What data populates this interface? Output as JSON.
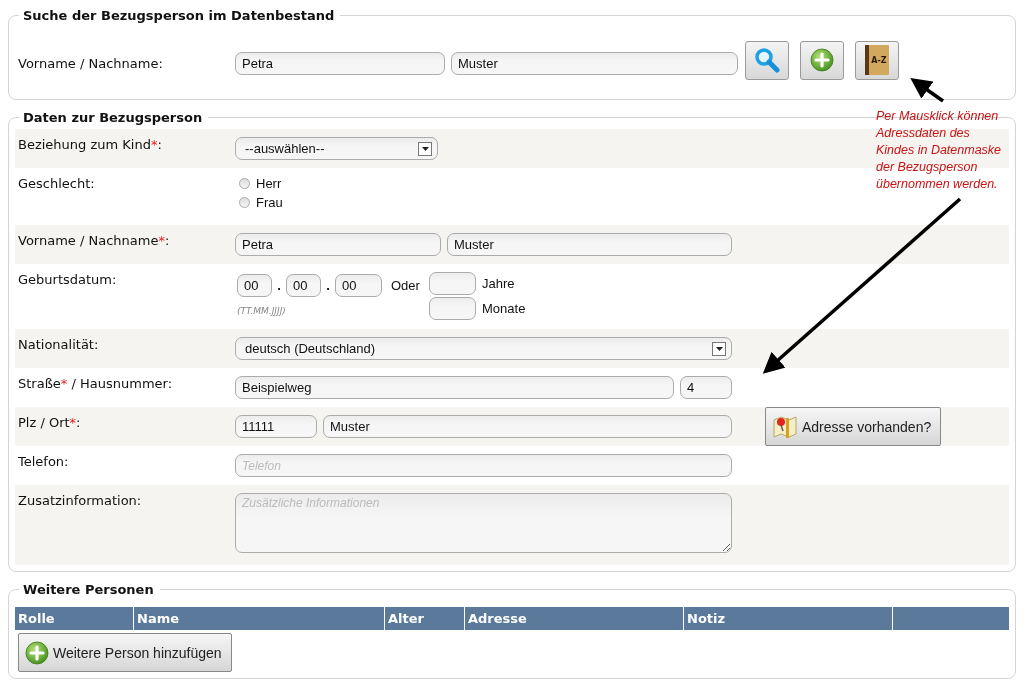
{
  "search": {
    "legend": "Suche der Bezugsperson im Datenbestand",
    "label": "Vorname / Nachname:",
    "first_name": "Petra",
    "last_name": "Muster",
    "buttons": [
      {
        "kind": "search"
      },
      {
        "kind": "add"
      },
      {
        "kind": "book",
        "icon_text": "A-Z"
      }
    ]
  },
  "details": {
    "legend": "Daten zur Bezugsperson",
    "rows": [
      {
        "kind": "short-select",
        "label": "Beziehung zum Kind",
        "mark": "*",
        "label_rest": ":",
        "value": "--auswählen--"
      },
      {
        "kind": "radio",
        "label": "Geschlecht:",
        "options": [
          {
            "label": "Herr",
            "selected": false
          },
          {
            "label": "Frau",
            "selected": false
          }
        ]
      },
      {
        "kind": "pair",
        "label": "Vorname / Nachname",
        "mark": "*",
        "label_rest": ":",
        "values": [
          "Petra",
          "Muster"
        ]
      },
      {
        "kind": "date",
        "label": "Geburtsdatum:",
        "parts": [
          "00",
          "00",
          "00"
        ],
        "separator": ".",
        "hint": "(TT.MM.JJJJ)",
        "or": "Oder",
        "units": [
          "Jahre",
          "Monate"
        ]
      },
      {
        "kind": "select",
        "label": "Nationalität:",
        "value": "deutsch (Deutschland)"
      },
      {
        "kind": "street",
        "label": "Straße",
        "mark": "*",
        "label_rest": " / Hausnummer:",
        "values": [
          "Beispielweg",
          "4"
        ]
      },
      {
        "kind": "zip",
        "label": "Plz / Ort",
        "mark": "*",
        "label_rest": ":",
        "values": [
          "11111",
          "Muster"
        ]
      },
      {
        "kind": "text",
        "label": "Telefon:",
        "placeholder": "Telefon"
      },
      {
        "kind": "textarea",
        "label": "Zusatzinformation:",
        "placeholder": "Zusätzliche Informationen"
      }
    ],
    "address_button": "Adresse vorhanden?"
  },
  "annotation": {
    "lines": [
      "Per Mausklick können",
      "Adressdaten des",
      "Kindes in Datenmaske",
      "der Bezugsperson",
      "übernommen werden."
    ]
  },
  "persons": {
    "legend": "Weitere Personen",
    "columns": [
      "Rolle",
      "Name",
      "Alter",
      "Adresse",
      "Notiz"
    ],
    "add_button": "Weitere Person hinzufügen"
  }
}
